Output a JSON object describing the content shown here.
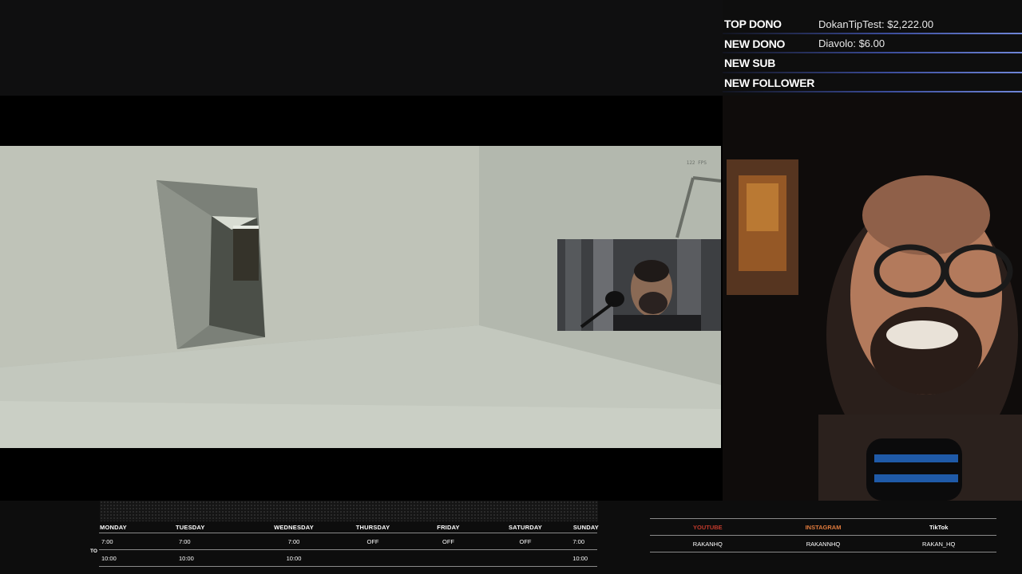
{
  "alerts": {
    "top_dono": {
      "label": "TOP DONO",
      "value": "DokanTipTest: $2,222.00"
    },
    "new_dono": {
      "label": "NEW DONO",
      "value": "Diavolo: $6.00"
    },
    "new_sub": {
      "label": "NEW SUB",
      "value": ""
    },
    "new_follower": {
      "label": "NEW FOLLOWER",
      "value": ""
    }
  },
  "game": {
    "fps_text": "122 FPS"
  },
  "schedule": {
    "to_label": "TO",
    "days": [
      "MONDAY",
      "TUESDAY",
      "WEDNESDAY",
      "THURSDAY",
      "FRIDAY",
      "SATURDAY",
      "SUNDAY"
    ],
    "start": [
      "7:00",
      "7:00",
      "7:00",
      "OFF",
      "OFF",
      "OFF",
      "7:00"
    ],
    "end": [
      "10:00",
      "10:00",
      "10:00",
      "",
      "",
      "",
      "10:00"
    ]
  },
  "socials": {
    "headers": [
      {
        "label": "YOUTUBE",
        "color": "#c0392b"
      },
      {
        "label": "INSTAGRAM",
        "color": "#e07a3c"
      },
      {
        "label": "TikTok",
        "color": "#ffffff"
      }
    ],
    "handles": [
      "RAKANHQ",
      "RAKANNHQ",
      "RAKAN_HQ"
    ]
  },
  "colors": {
    "alert_line_end": "#6f86d8",
    "background": "#0d0d0d"
  }
}
